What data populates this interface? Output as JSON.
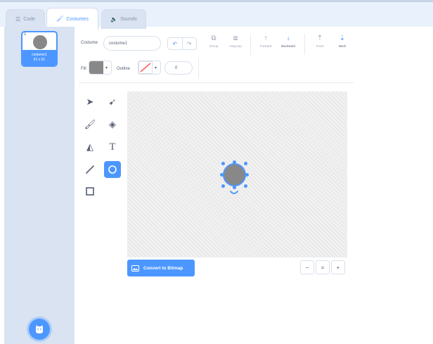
{
  "tabs": [
    {
      "label": "Code",
      "icon": "code-icon"
    },
    {
      "label": "Costumes",
      "icon": "brush-icon",
      "active": true
    },
    {
      "label": "Sounds",
      "icon": "speaker-icon"
    }
  ],
  "costumes": [
    {
      "index": "1",
      "name": "costume1",
      "size": "61 x 61",
      "selected": true
    }
  ],
  "toolbar": {
    "costume_label": "Costume",
    "costume_name": "costume1",
    "group": "Group",
    "ungroup": "Ungroup",
    "forward": "Forward",
    "backward": "Backward",
    "front": "Front",
    "back": "Back",
    "fill_label": "Fill",
    "fill_color": "#888888",
    "outline_label": "Outline",
    "outline_width": "0"
  },
  "tools": [
    "select",
    "reshape",
    "brush",
    "eraser",
    "fill",
    "text",
    "line",
    "circle",
    "rectangle"
  ],
  "active_tool": "circle",
  "canvas": {
    "convert_label": "Convert to Bitmap",
    "zoom_out": "−",
    "zoom_reset": "=",
    "zoom_in": "+"
  },
  "colors": {
    "accent": "#4c97ff",
    "sidebar": "#d9e3f2",
    "tabbar": "#e9f1fc"
  }
}
